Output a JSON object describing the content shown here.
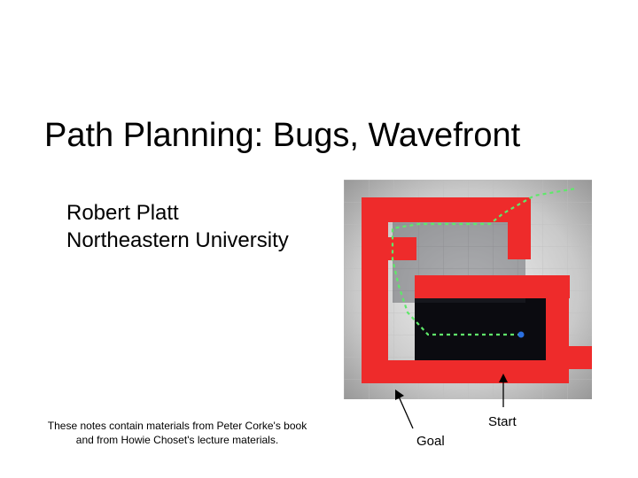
{
  "title": "Path Planning: Bugs, Wavefront",
  "author_name": "Robert Platt",
  "author_affiliation": "Northeastern University",
  "footer_line1": "These notes contain materials from Peter Corke's book",
  "footer_line2": "and from Howie Choset's lecture materials.",
  "labels": {
    "start": "Start",
    "goal": "Goal"
  },
  "colors": {
    "obstacle": "#ee2b2b",
    "path": "#7ef27e",
    "freespace_dark": "#0b0b10",
    "grid_bg_light": "#e8e8e8",
    "grid_bg_dark": "#9a9a9a",
    "start_dot": "#2a6fe0"
  }
}
